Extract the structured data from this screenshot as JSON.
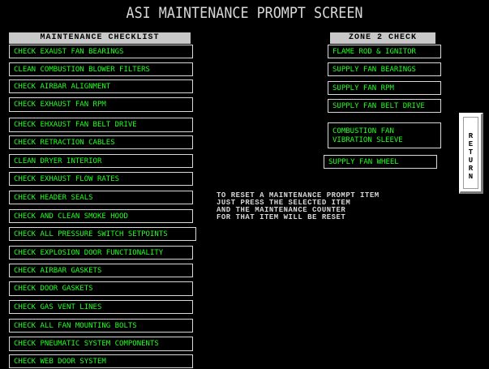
{
  "title": "ASI MAINTENANCE PROMPT SCREEN",
  "checklist": {
    "header": "MAINTENANCE CHECKLIST",
    "items": [
      "CHECK EXAUST FAN BEARINGS",
      "CLEAN COMBUSTION BLOWER FILTERS",
      "CHECK AIRBAR ALIGNMENT",
      "CHECK EXHAUST FAN RPM",
      "CHECK EHXAUST FAN BELT DRIVE",
      "CHECK RETRACTION CABLES",
      "CLEAN DRYER INTERIOR",
      "CHECK EXHAUST FLOW RATES",
      "CHECK HEADER SEALS",
      "CHECK AND CLEAN SMOKE HOOD",
      "CHECK ALL PRESSURE SWITCH SETPOINTS",
      "CHECK EXPLOSION DOOR FUNCTIONALITY",
      "CHECK AIRBAR GASKETS",
      "CHECK DOOR GASKETS",
      "CHECK GAS VENT LINES",
      "CHECK ALL FAN MOUNTING BOLTS",
      "CHECK PNEUMATIC SYSTEM COMPONENTS",
      "CHECK WEB DOOR SYSTEM"
    ]
  },
  "zone": {
    "header": "ZONE 2 CHECK",
    "items": [
      "FLAME ROD & IGNITOR",
      "SUPPLY FAN BEARINGS",
      "SUPPLY FAN RPM",
      "SUPPLY FAN BELT DRIVE",
      "COMBUSTION FAN\nVIBRATION SLEEVE",
      "SUPPLY FAN WHEEL"
    ]
  },
  "info_text": "TO RESET A MAINTENANCE PROMPT ITEM\nJUST PRESS THE SELECTED ITEM\nAND THE MAINTENANCE COUNTER\nFOR THAT ITEM WILL BE RESET",
  "return_button": {
    "letters": [
      "R",
      "E",
      "T",
      "U",
      "R",
      "N"
    ]
  },
  "colors": {
    "background": "#000000",
    "item_text": "#22ff22",
    "header_bg": "#c8c8c8",
    "title_text": "#d8d8d8"
  }
}
